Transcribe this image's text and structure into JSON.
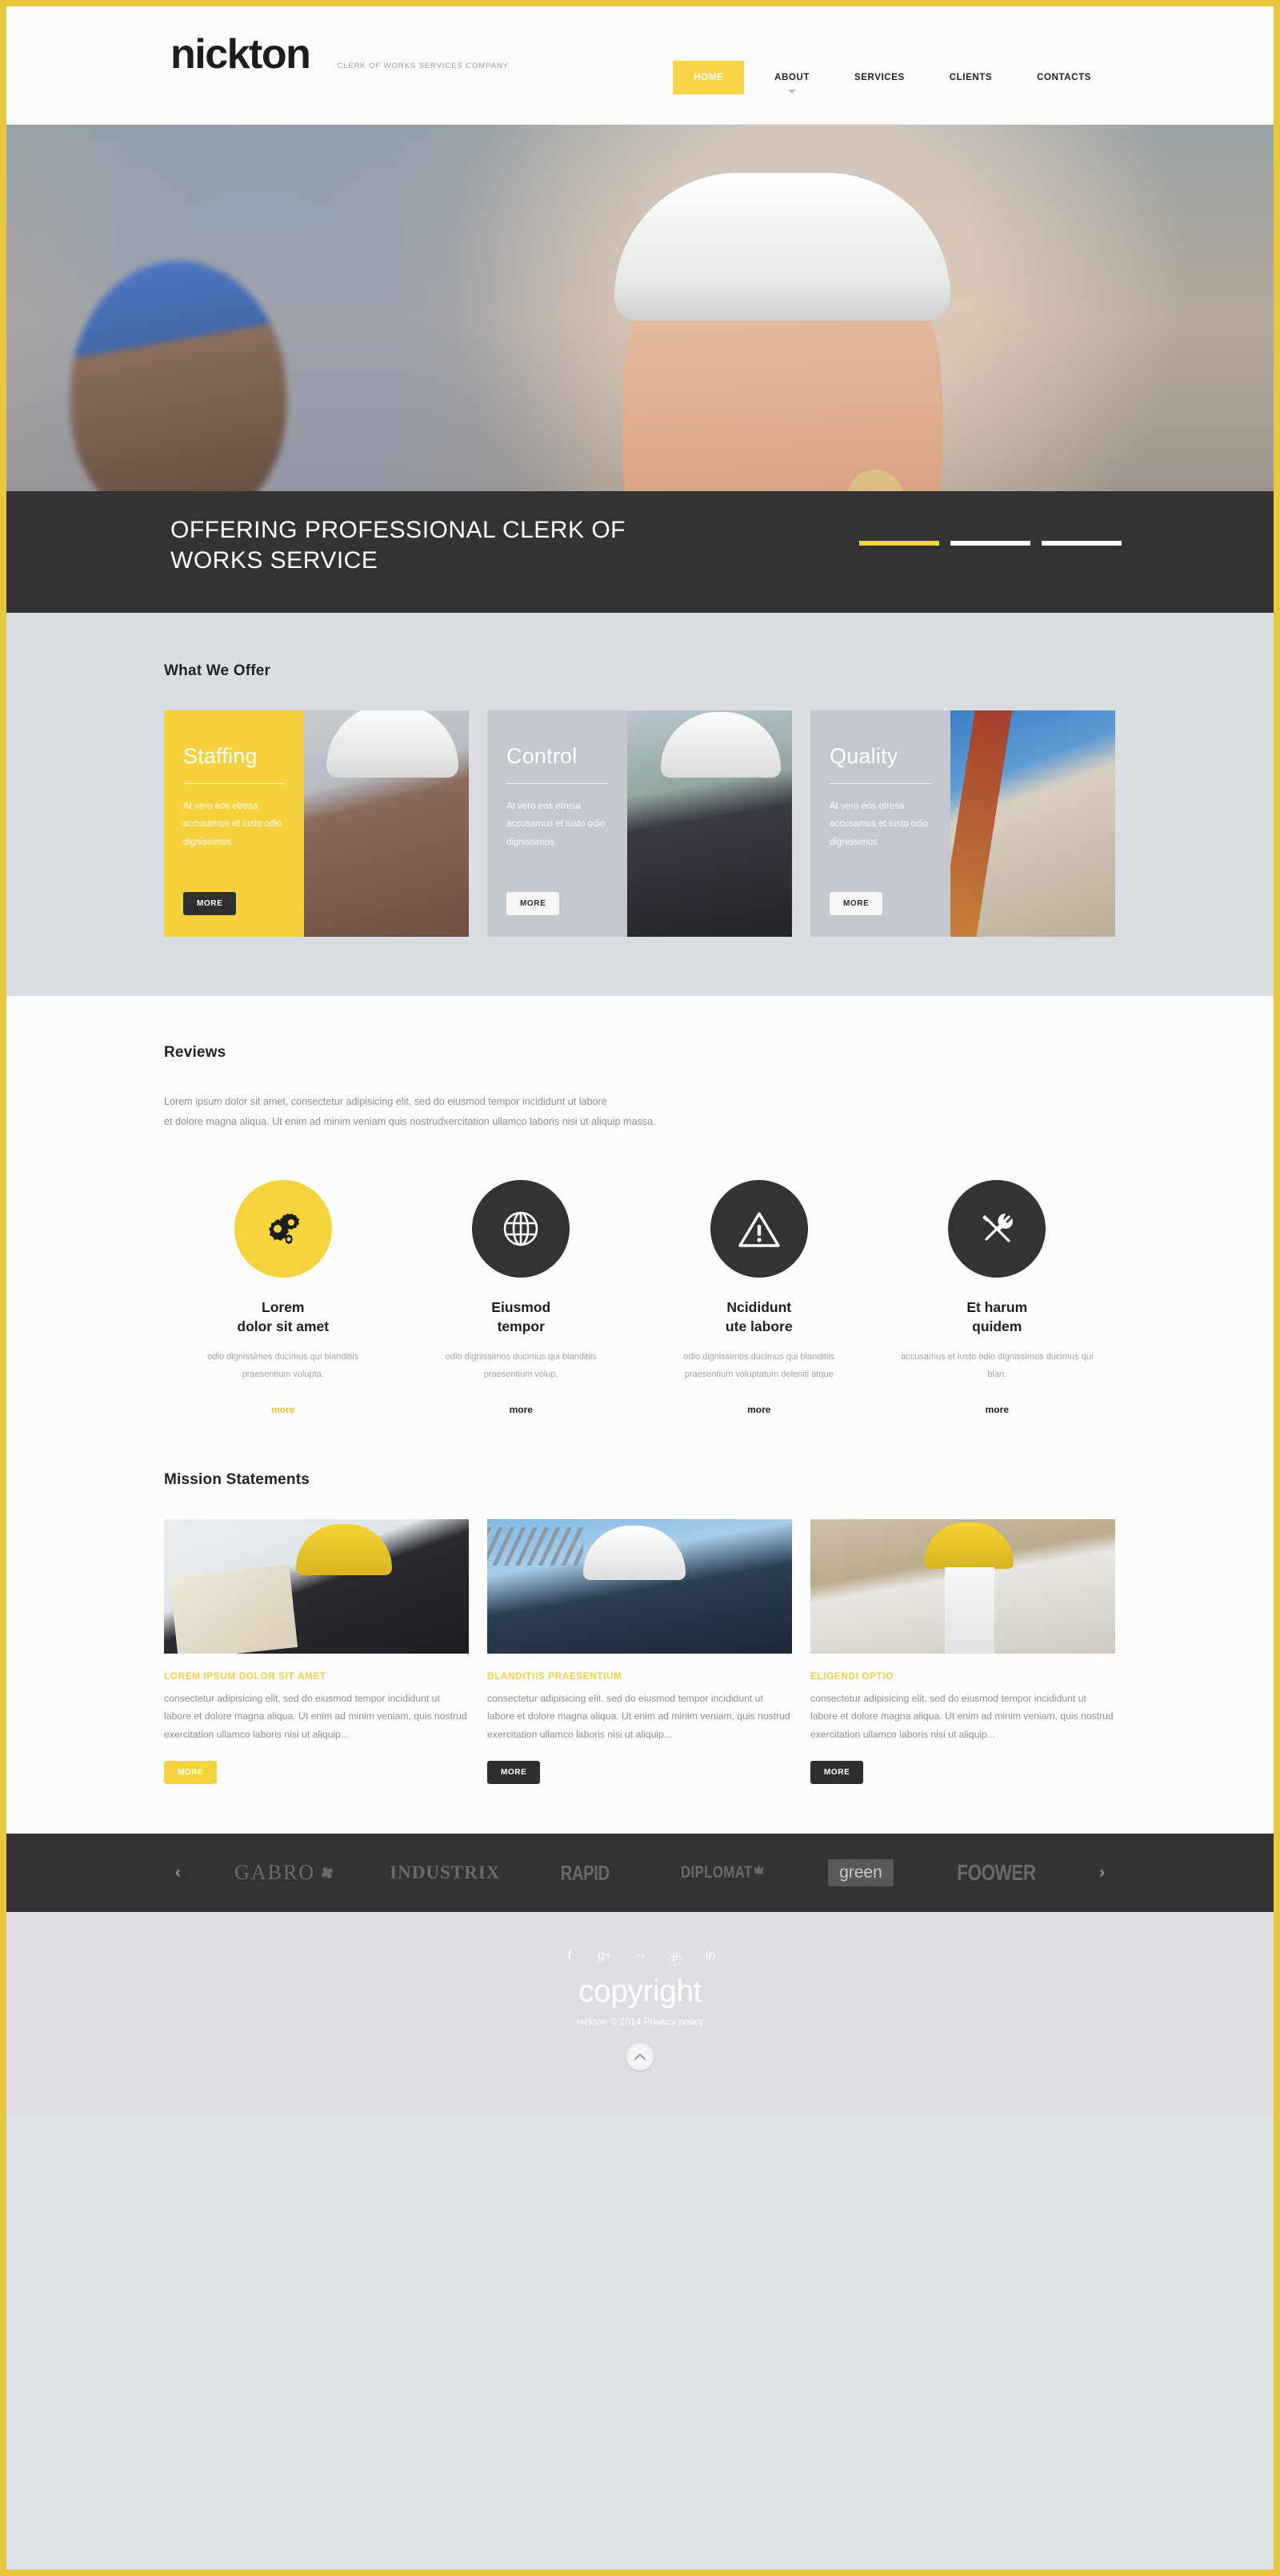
{
  "header": {
    "logo_name": "nickton",
    "logo_tagline": "CLERK OF WORKS SERVICES COMPANY",
    "nav": [
      {
        "label": "HOME",
        "active": true,
        "caret": false
      },
      {
        "label": "ABOUT",
        "active": false,
        "caret": true
      },
      {
        "label": "SERVICES",
        "active": false,
        "caret": false
      },
      {
        "label": "CLIENTS",
        "active": false,
        "caret": false
      },
      {
        "label": "CONTACTS",
        "active": false,
        "caret": false
      }
    ]
  },
  "hero": {
    "caption": "OFFERING  PROFESSIONAL CLERK OF WORKS SERVICE",
    "slides": 3,
    "active_slide": 1,
    "accent_color": "#f5d33d"
  },
  "offer": {
    "title": "What We Offer",
    "cards": [
      {
        "title": "Staffing",
        "text": "At vero eos etresa accusamus et iusto odio dignissimos",
        "button": "MORE",
        "style": "yellow"
      },
      {
        "title": "Control",
        "text": "At vero eos etresa accusamus et iusto odio dignissimos",
        "button": "MORE",
        "style": "grey"
      },
      {
        "title": "Quality",
        "text": "At vero eos etresa accusamus et iusto odio dignissimos",
        "button": "MORE",
        "style": "grey"
      }
    ]
  },
  "reviews": {
    "title": "Reviews",
    "lead_line1": "Lorem ipsum dolor sit amet, consectetur adipisicing elit, sed do eiusmod tempor incididunt ut labore",
    "lead_line2": "et dolore magna aliqua. Ut enim ad minim veniam quis nostrudxercitation ullamco laboris nisi ut aliquip massa.",
    "items": [
      {
        "icon": "gears-icon",
        "circle": "yellow",
        "title_line1": "Lorem",
        "title_line2": "dolor sit amet",
        "text": "odio dignissimos ducimus qui blanditiis praesentium volupta.",
        "more": "more",
        "more_accent": true
      },
      {
        "icon": "globe-icon",
        "circle": "dark",
        "title_line1": "Eiusmod",
        "title_line2": "tempor",
        "text": "odio dignissimos ducimus qui blanditiis praesentium volup.",
        "more": "more",
        "more_accent": false
      },
      {
        "icon": "warning-icon",
        "circle": "dark",
        "title_line1": "Ncididunt",
        "title_line2": "ute labore",
        "text": "odio dignissimos ducimus qui blanditiis praesentium voluptatum deleniti atque",
        "more": "more",
        "more_accent": false
      },
      {
        "icon": "tools-icon",
        "circle": "dark",
        "title_line1": "Et harum",
        "title_line2": "quidem",
        "text": "accusamus et iusto odio dignissimos ducimus qui blan.",
        "more": "more",
        "more_accent": false
      }
    ]
  },
  "mission": {
    "title": "Mission Statements",
    "cards": [
      {
        "heading": "LOREM IPSUM DOLOR SIT AMET",
        "text": "consectetur adipisicing elit, sed do eiusmod tempor incididunt ut labore et dolore magna aliqua. Ut enim ad minim veniam, quis nostrud exercitation ullamco laboris nisi ut aliquip...",
        "button": "MORE",
        "button_style": "yellow"
      },
      {
        "heading": "BLANDITIIS PRAESENTIUM",
        "text": "consectetur adipisicing elit, sed do eiusmod tempor incididunt ut labore et dolore magna aliqua. Ut enim ad minim veniam, quis nostrud exercitation ullamco laboris nisi ut aliquip...",
        "button": "MORE",
        "button_style": "dark"
      },
      {
        "heading": "ELIGENDI OPTIO",
        "text": "consectetur adipisicing elit, sed do eiusmod tempor incididunt ut labore et dolore magna aliqua. Ut enim ad minim veniam, quis nostrud exercitation ullamco laboris nisi ut aliquip...",
        "button": "MORE",
        "button_style": "dark"
      }
    ]
  },
  "partners": {
    "prev": "‹",
    "next": "›",
    "logos": [
      {
        "name": "GABRO"
      },
      {
        "name": "INDUSTRIX"
      },
      {
        "name": "RAPID"
      },
      {
        "name": "DIPLOMAT"
      },
      {
        "name": "green"
      },
      {
        "name": "FOOWER"
      }
    ]
  },
  "footer": {
    "social": [
      {
        "icon": "facebook-icon",
        "glyph": "f"
      },
      {
        "icon": "google-plus-icon",
        "glyph": "g+"
      },
      {
        "icon": "rss-icon",
        "glyph": "⤳"
      },
      {
        "icon": "pinterest-icon",
        "glyph": "Ⓟ"
      },
      {
        "icon": "linkedin-icon",
        "glyph": "in"
      }
    ],
    "copyright_big": "copyright",
    "copyright_small_name": "nickton",
    "copyright_small_rest": "© 2014",
    "privacy": "Privacy policy",
    "to_top": "to-top-icon"
  }
}
